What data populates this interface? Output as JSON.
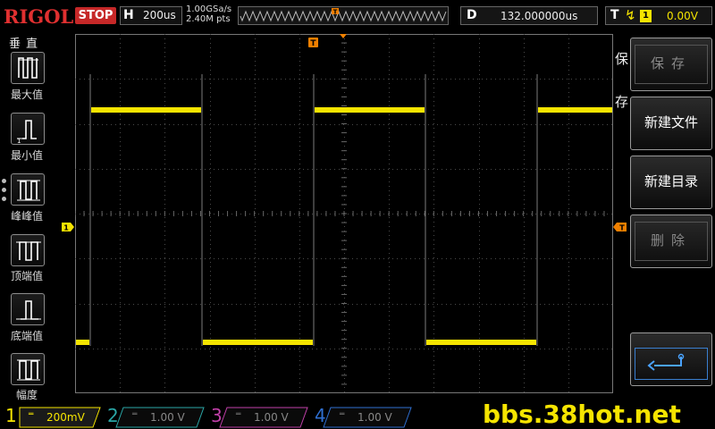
{
  "brand": "RIGOL",
  "run_state": "STOP",
  "timebase": {
    "key": "H",
    "value": "200us"
  },
  "acquisition": {
    "sample_rate": "1.00GSa/s",
    "memory_depth": "2.40M pts"
  },
  "delay": {
    "key": "D",
    "value": "132.000000us"
  },
  "trigger": {
    "key": "T",
    "edge": "↯",
    "source": "1",
    "level": "0.00V"
  },
  "trigger_marker": "T",
  "left_menu": {
    "title": "垂直",
    "items": [
      {
        "label": "最大值",
        "icon": "vmax-icon"
      },
      {
        "label": "最小值",
        "icon": "vmin-icon"
      },
      {
        "label": "峰峰值",
        "icon": "vpp-icon"
      },
      {
        "label": "顶端值",
        "icon": "vtop-icon"
      },
      {
        "label": "底端值",
        "icon": "vbase-icon"
      },
      {
        "label": "幅度",
        "icon": "vamp-icon"
      }
    ]
  },
  "right_menu": {
    "title": "保存",
    "items": [
      {
        "label": "保存",
        "enabled": false
      },
      {
        "label": "新建文件",
        "enabled": true
      },
      {
        "label": "新建目录",
        "enabled": true
      },
      {
        "label": "删除",
        "enabled": false
      },
      {
        "label": "",
        "icon": "return-icon",
        "enabled": true
      }
    ]
  },
  "channels": [
    {
      "num": "1",
      "coupling": "═",
      "scale": "200mV",
      "active": true,
      "color": "#f5e400"
    },
    {
      "num": "2",
      "coupling": "═",
      "scale": "1.00 V",
      "active": false,
      "color": "#2aa6a6"
    },
    {
      "num": "3",
      "coupling": "═",
      "scale": "1.00 V",
      "active": false,
      "color": "#c03fa8"
    },
    {
      "num": "4",
      "coupling": "═",
      "scale": "1.00 V",
      "active": false,
      "color": "#2f6fd0"
    }
  ],
  "channel1_marker": "1",
  "watermark": "bbs.38hot.net",
  "colors": {
    "ch1": "#f5e400",
    "grid": "#4a4a4a",
    "stop": "#c62828",
    "trigger_marker": "#f08000"
  }
}
